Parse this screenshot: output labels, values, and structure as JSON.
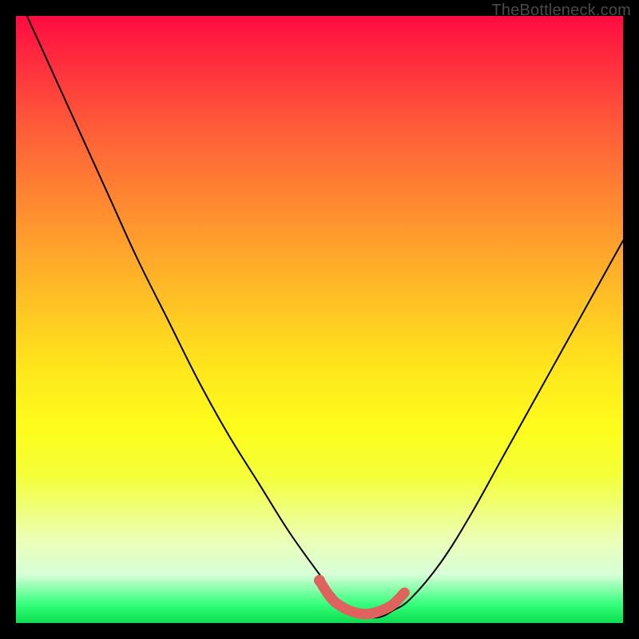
{
  "watermark": "TheBottleneck.com",
  "chart_data": {
    "type": "line",
    "title": "",
    "xlabel": "",
    "ylabel": "",
    "xlim": [
      0,
      100
    ],
    "ylim": [
      0,
      100
    ],
    "series": [
      {
        "name": "bottleneck-curve",
        "x": [
          0,
          5,
          10,
          15,
          20,
          25,
          30,
          35,
          40,
          45,
          50,
          53,
          56,
          58,
          60,
          62,
          65,
          70,
          75,
          80,
          85,
          90,
          95,
          100
        ],
        "y": [
          104,
          93,
          82,
          71,
          60,
          50,
          40,
          31,
          23,
          15,
          8,
          4,
          2,
          1,
          1,
          2,
          4,
          10,
          18,
          27,
          36,
          45,
          54,
          63
        ]
      }
    ],
    "highlight_region": {
      "name": "optimal-zone",
      "x": [
        50,
        52,
        54,
        56,
        58,
        60,
        62,
        64
      ],
      "y": [
        7,
        4,
        2.5,
        1.7,
        1.5,
        2,
        3,
        5
      ],
      "color": "#e0625f",
      "stroke_width": 13
    },
    "highlight_dot": {
      "x": 50,
      "y": 7,
      "r": 7,
      "color": "#e0625f"
    }
  }
}
